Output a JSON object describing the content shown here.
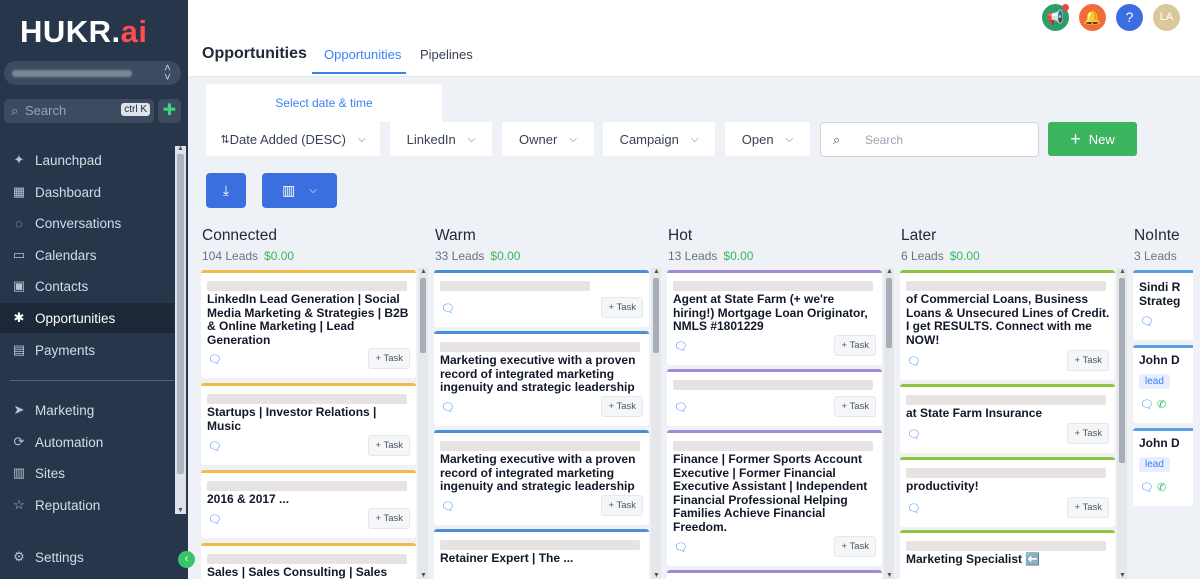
{
  "sidebar": {
    "logo_main": "HUKR.",
    "logo_accent": "ai",
    "search_placeholder": "Search",
    "search_shortcut": "ctrl K",
    "items": [
      {
        "label": "Launchpad",
        "icon": "rocket-icon",
        "glyph": "✦"
      },
      {
        "label": "Dashboard",
        "icon": "grid-icon",
        "glyph": "▦"
      },
      {
        "label": "Conversations",
        "icon": "chat-icon",
        "glyph": "◌"
      },
      {
        "label": "Calendars",
        "icon": "calendar-icon",
        "glyph": "▭"
      },
      {
        "label": "Contacts",
        "icon": "contacts-icon",
        "glyph": "▣"
      },
      {
        "label": "Opportunities",
        "icon": "opportunities-icon",
        "glyph": "✱"
      },
      {
        "label": "Payments",
        "icon": "payments-icon",
        "glyph": "▤"
      },
      {
        "label": "Marketing",
        "icon": "send-icon",
        "glyph": "➤"
      },
      {
        "label": "Automation",
        "icon": "automation-icon",
        "glyph": "⟳"
      },
      {
        "label": "Sites",
        "icon": "sites-icon",
        "glyph": "▥"
      },
      {
        "label": "Reputation",
        "icon": "star-icon",
        "glyph": "☆"
      },
      {
        "label": "Settings",
        "icon": "gear-icon",
        "glyph": "⚙"
      }
    ]
  },
  "header": {
    "title": "Opportunities",
    "tabs": [
      "Opportunities",
      "Pipelines"
    ],
    "avatar": "LA"
  },
  "filters": {
    "date_range": "Select date & time",
    "sort": "Date Added (DESC)",
    "source": "LinkedIn",
    "owner": "Owner",
    "campaign": "Campaign",
    "status": "Open",
    "search_placeholder": "Search",
    "new_label": "New"
  },
  "task_label": "+ Task",
  "columns": [
    {
      "name": "Connected",
      "leads": "104 Leads",
      "amount": "$0.00"
    },
    {
      "name": "Warm",
      "leads": "33 Leads",
      "amount": "$0.00"
    },
    {
      "name": "Hot",
      "leads": "13 Leads",
      "amount": "$0.00"
    },
    {
      "name": "Later",
      "leads": "6 Leads",
      "amount": "$0.00"
    },
    {
      "name": "NoInte",
      "leads": "3 Leads",
      "amount": ""
    }
  ],
  "cards": {
    "connected": [
      "LinkedIn Lead Generation | Social Media Marketing & Strategies | B2B & Online Marketing | Lead Generation",
      "Startups | Investor Relations | Music",
      "2016 & 2017 ...",
      "Sales | Sales Consulting | Sales"
    ],
    "warm": [
      "",
      "Marketing executive with a proven record of integrated marketing ingenuity and strategic leadership",
      "Marketing executive with a proven record of integrated marketing ingenuity and strategic leadership",
      "Retainer Expert | The ..."
    ],
    "hot": [
      "Agent at State Farm (+ we're hiring!) Mortgage Loan Originator, NMLS #1801229",
      "",
      "Finance | Former Sports Account Executive | Former Financial Executive Assistant | Independent Financial Professional Helping Families Achieve Financial Freedom."
    ],
    "later": [
      "of Commercial Loans, Business Loans & Unsecured Lines of Credit. I get RESULTS. Connect with me NOW!",
      "at State Farm Insurance",
      "productivity!",
      "Marketing Specialist ⬅️"
    ],
    "nointerest": [
      {
        "title": "Sindi R Strateg",
        "tag": ""
      },
      {
        "title": "John D",
        "tag": "lead"
      },
      {
        "title": "John D",
        "tag": "lead"
      }
    ]
  },
  "colors": {
    "sidebar": "#27364a",
    "accent": "#3b82f6",
    "success": "#3cb55f",
    "connected": "#f4bb4a",
    "warm": "#4a8fd8",
    "hot": "#a48ad6",
    "later": "#8cc63f",
    "nointerest": "#5aa0e8"
  }
}
